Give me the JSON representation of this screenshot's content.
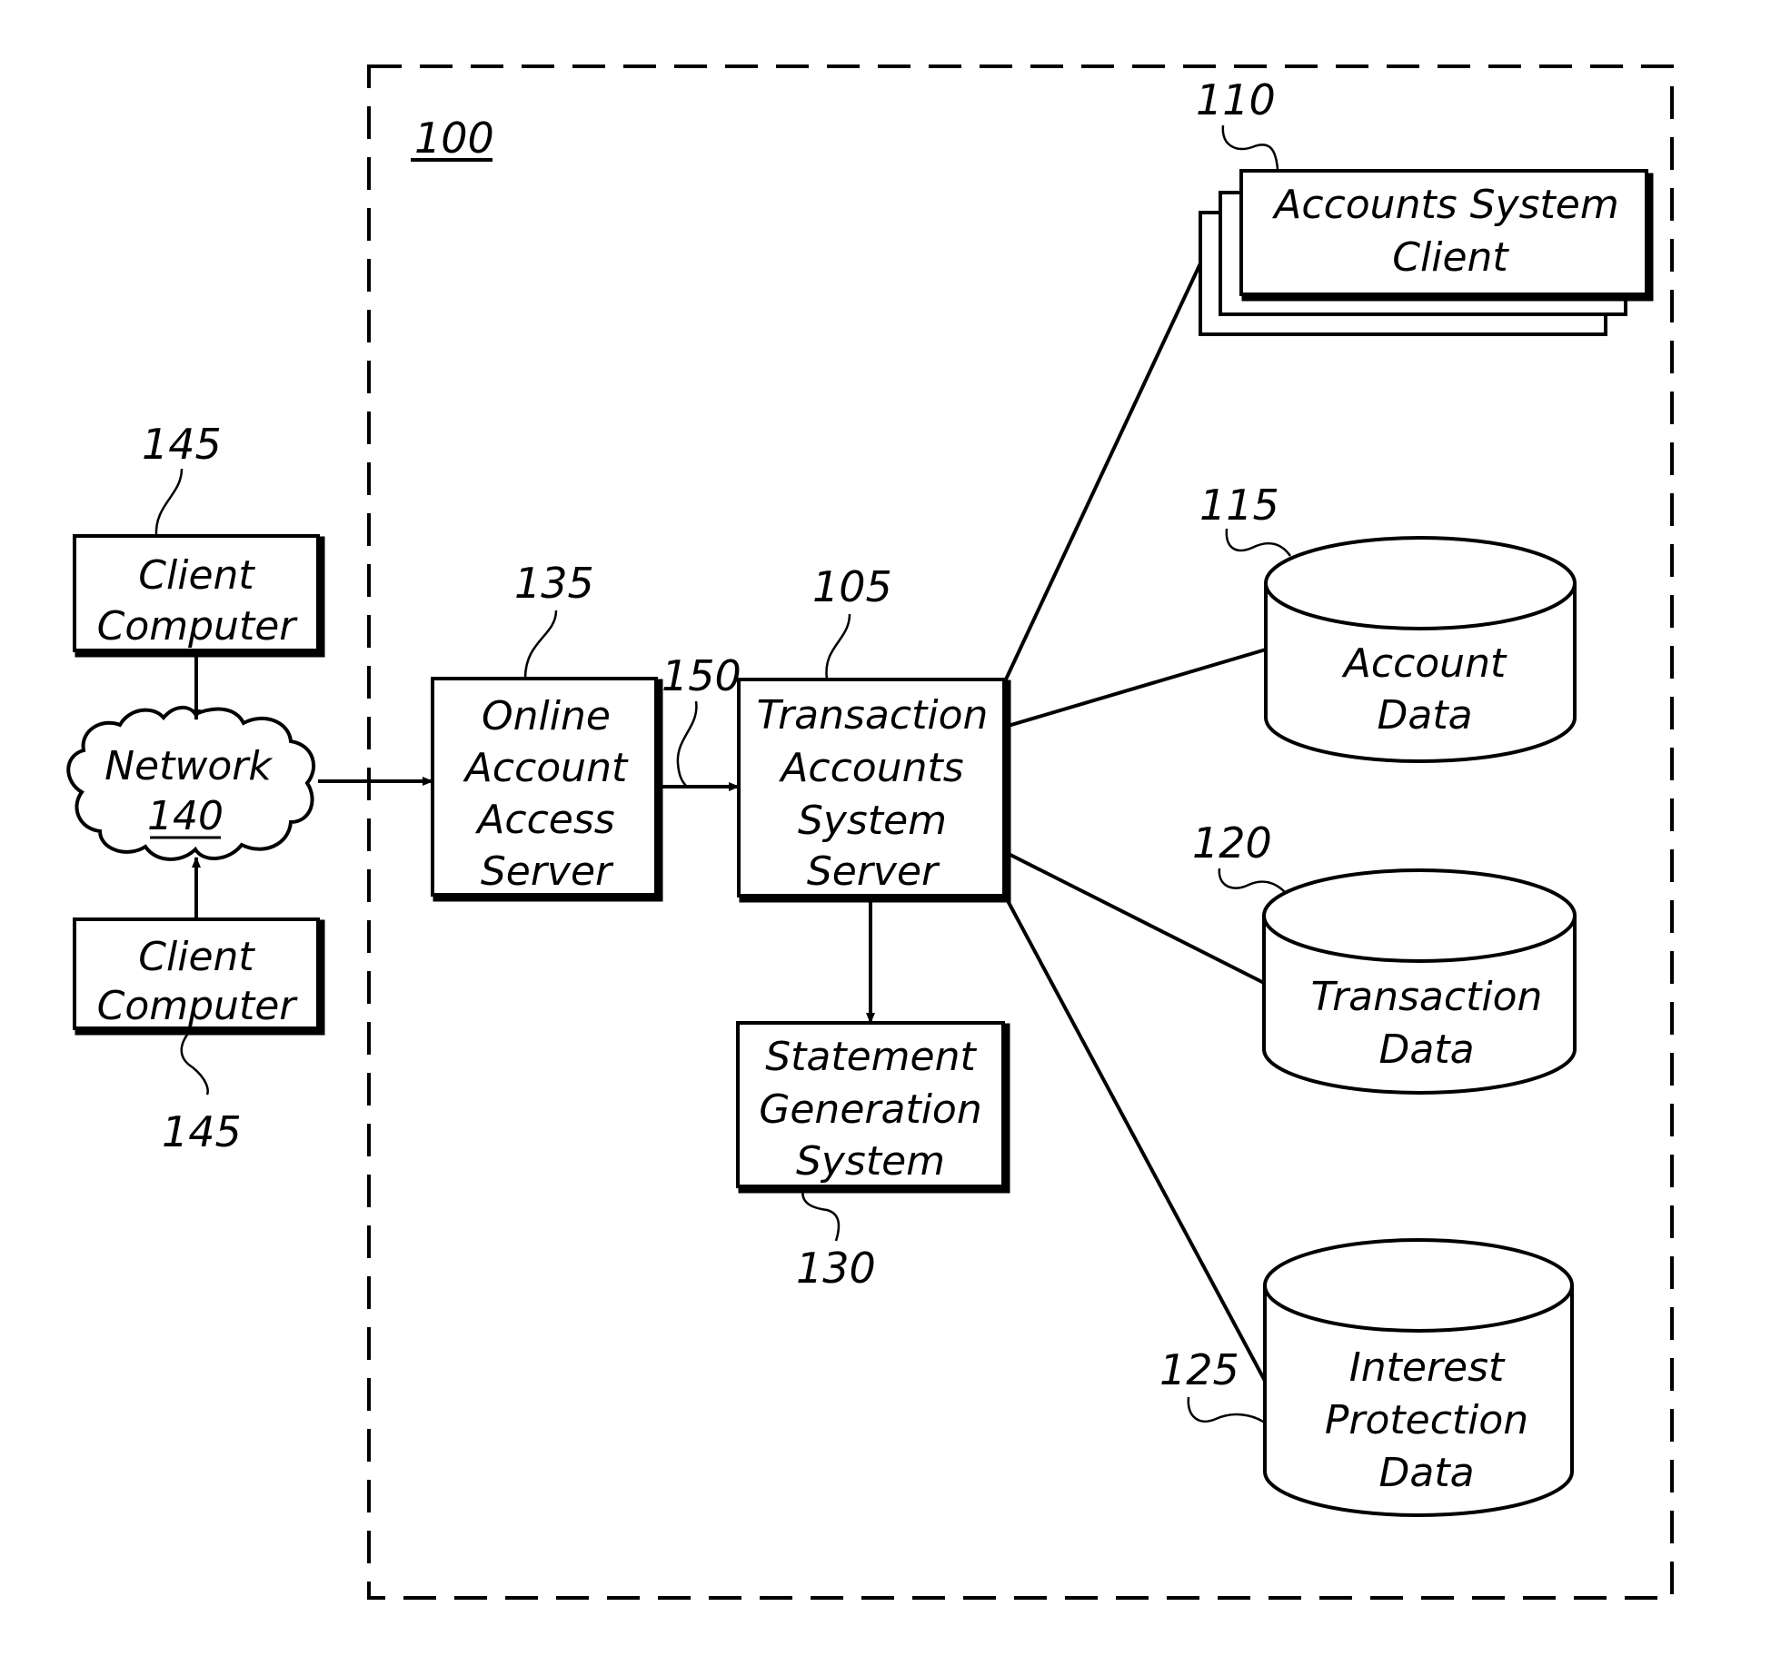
{
  "diagram": {
    "system": {
      "ref": "100"
    },
    "nodes": {
      "client_top": {
        "ref": "145",
        "lines": [
          "Client",
          "Computer"
        ]
      },
      "client_bottom": {
        "ref": "145",
        "lines": [
          "Client",
          "Computer"
        ]
      },
      "network": {
        "ref": "140",
        "lines": [
          "Network"
        ]
      },
      "online_server": {
        "ref": "135",
        "lines": [
          "Online",
          "Account",
          "Access",
          "Server"
        ]
      },
      "connection": {
        "ref": "150"
      },
      "tas_server": {
        "ref": "105",
        "lines": [
          "Transaction",
          "Accounts",
          "System",
          "Server"
        ]
      },
      "statement": {
        "ref": "130",
        "lines": [
          "Statement",
          "Generation",
          "System"
        ]
      },
      "accounts_client": {
        "ref": "110",
        "lines": [
          "Accounts  System",
          "Client"
        ]
      },
      "account_data": {
        "ref": "115",
        "lines": [
          "Account",
          "Data"
        ]
      },
      "transaction_data": {
        "ref": "120",
        "lines": [
          "Transaction",
          "Data"
        ]
      },
      "interest_data": {
        "ref": "125",
        "lines": [
          "Interest",
          "Protection",
          "Data"
        ]
      }
    },
    "edges": [
      {
        "from": "client_top",
        "to": "network",
        "directed": true
      },
      {
        "from": "client_bottom",
        "to": "network",
        "directed": true
      },
      {
        "from": "network",
        "to": "online_server",
        "directed": true
      },
      {
        "from": "online_server",
        "to": "tas_server",
        "directed": true
      },
      {
        "from": "tas_server",
        "to": "statement",
        "directed": true
      },
      {
        "from": "tas_server",
        "to": "accounts_client",
        "directed": false
      },
      {
        "from": "tas_server",
        "to": "account_data",
        "directed": false
      },
      {
        "from": "tas_server",
        "to": "transaction_data",
        "directed": false
      },
      {
        "from": "tas_server",
        "to": "interest_data",
        "directed": false
      }
    ]
  }
}
